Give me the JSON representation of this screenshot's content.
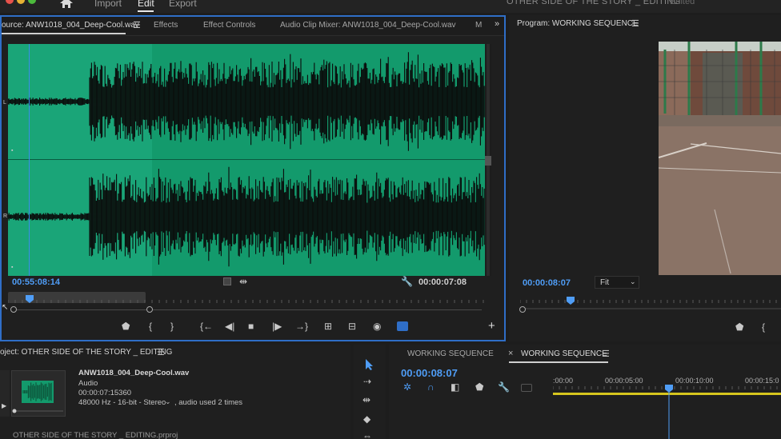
{
  "menu": {
    "items": [
      "Import",
      "Edit",
      "Export"
    ],
    "active_index": 1
  },
  "document": {
    "title": "OTHER SIDE OF THE STORY _ EDITING",
    "status": "Edited"
  },
  "source": {
    "tabs": [
      "ource: ANW1018_004_Deep-Cool.wav",
      "Effects",
      "Effect Controls",
      "Audio Clip Mixer: ANW1018_004_Deep-Cool.wav",
      "M"
    ],
    "channel_left": "L",
    "channel_right": "R",
    "timecode_current": "00:55:08:14",
    "timecode_duration": "00:00:07:08"
  },
  "program": {
    "title": "Program: WORKING SEQUENCE",
    "timecode": "00:00:08:07",
    "zoom": "Fit"
  },
  "project": {
    "title": "oject: OTHER SIDE OF THE STORY _ EDITING",
    "clip_name": "ANW1018_004_Deep-Cool.wav",
    "clip_type": "Audio",
    "clip_duration": "00:00:07:15360",
    "clip_format": "48000 Hz - 16-bit - Stereo",
    "clip_usage": ", audio used 2 times",
    "footer": "OTHER SIDE OF THE STORY _ EDITING.prproj"
  },
  "timeline": {
    "tabs": [
      "WORKING SEQUENCE",
      "WORKING SEQUENCE"
    ],
    "timecode": "00:00:08:07",
    "ruler_labels": [
      ":00:00",
      "00:00:05:00",
      "00:00:10:00",
      "00:00:15:0"
    ]
  },
  "colors": {
    "accent": "#2f6ec7",
    "timecode": "#4f9df6",
    "waveform_bg": "#139a6c"
  }
}
